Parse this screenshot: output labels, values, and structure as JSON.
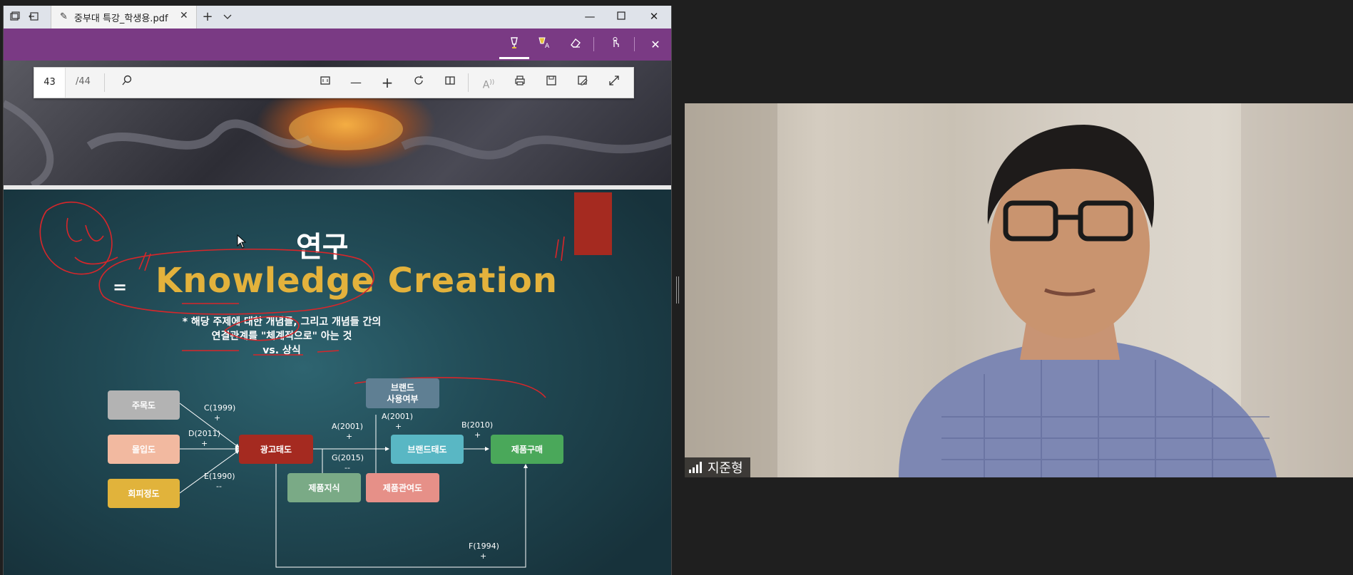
{
  "window": {
    "tab_title": "중부대 특강_학생용.pdf",
    "page_current": "43",
    "page_total": "/44"
  },
  "icons": {
    "tab_actions": "tab-actions-icon",
    "back": "back-icon",
    "pen": "pen-icon",
    "close": "close-icon",
    "new_tab": "plus-icon",
    "tab_list": "chevron-down-icon",
    "minimize": "minimize-icon",
    "maximize": "maximize-icon",
    "draw": "draw-icon",
    "highlight": "highlight-icon",
    "erase": "eraser-icon",
    "touch_write": "touch-write-icon",
    "search": "search-icon",
    "fit_page": "fit-page-icon",
    "zoom_out": "zoom-out-icon",
    "zoom_in": "zoom-in-icon",
    "rotate": "rotate-icon",
    "page_view": "page-view-icon",
    "read_aloud": "read-aloud-icon",
    "print": "print-icon",
    "save": "save-icon",
    "save_as": "save-as-icon",
    "fullscreen": "fullscreen-icon"
  },
  "slide": {
    "title": "연구",
    "heading": "Knowledge Creation",
    "desc_line1": "* 해당 주제에 대한 개념들, 그리고 개념들 간의",
    "desc_line2": "연결관계를 \"체계적으로\" 아는 것",
    "desc_line3": "vs. 상식",
    "nodes": {
      "n1": "주목도",
      "n2": "몰입도",
      "n3": "회피정도",
      "n4": "광고태도",
      "n5_line1": "브랜드",
      "n5_line2": "사용여부",
      "n6": "브랜드태도",
      "n7": "제품구매",
      "n8": "제품지식",
      "n9": "제품관여도"
    },
    "edges": {
      "c": "C(1999)",
      "d": "D(2011)",
      "e": "E(1990)",
      "a1": "A(2001)",
      "g": "G(2015)",
      "a2": "A(2001)",
      "b": "B(2010)",
      "f": "F(1994)",
      "plus": "+",
      "minus": "--"
    }
  },
  "video": {
    "participant_name": "지준형"
  },
  "colors": {
    "inkbar": "#7a3a84",
    "heading": "#e3b23c",
    "annotation": "#d8262a"
  }
}
